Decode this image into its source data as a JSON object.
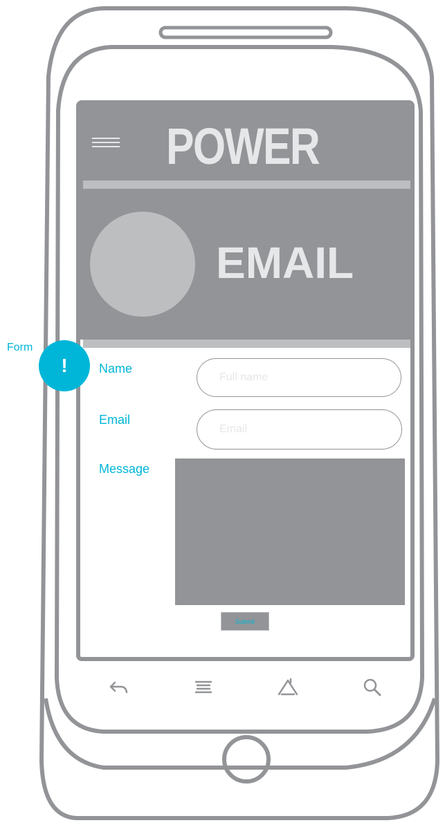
{
  "app": {
    "title": "POWER",
    "subtitle": "EMAIL"
  },
  "form": {
    "name_label": "Name",
    "name_placeholder": "Full name",
    "email_label": "Email",
    "email_placeholder": "Email",
    "message_label": "Message",
    "submit_label": "Submit"
  },
  "annotation": {
    "label": "Form",
    "badge": "!"
  },
  "softkeys": [
    "back-icon",
    "menu-icon",
    "home-icon",
    "search-icon"
  ],
  "colors": {
    "accent": "#00b6d8",
    "phone_outline": "#929497",
    "header_bg": "#929497",
    "light_gray": "#bcbec0",
    "header_text": "#e6e7e8"
  }
}
